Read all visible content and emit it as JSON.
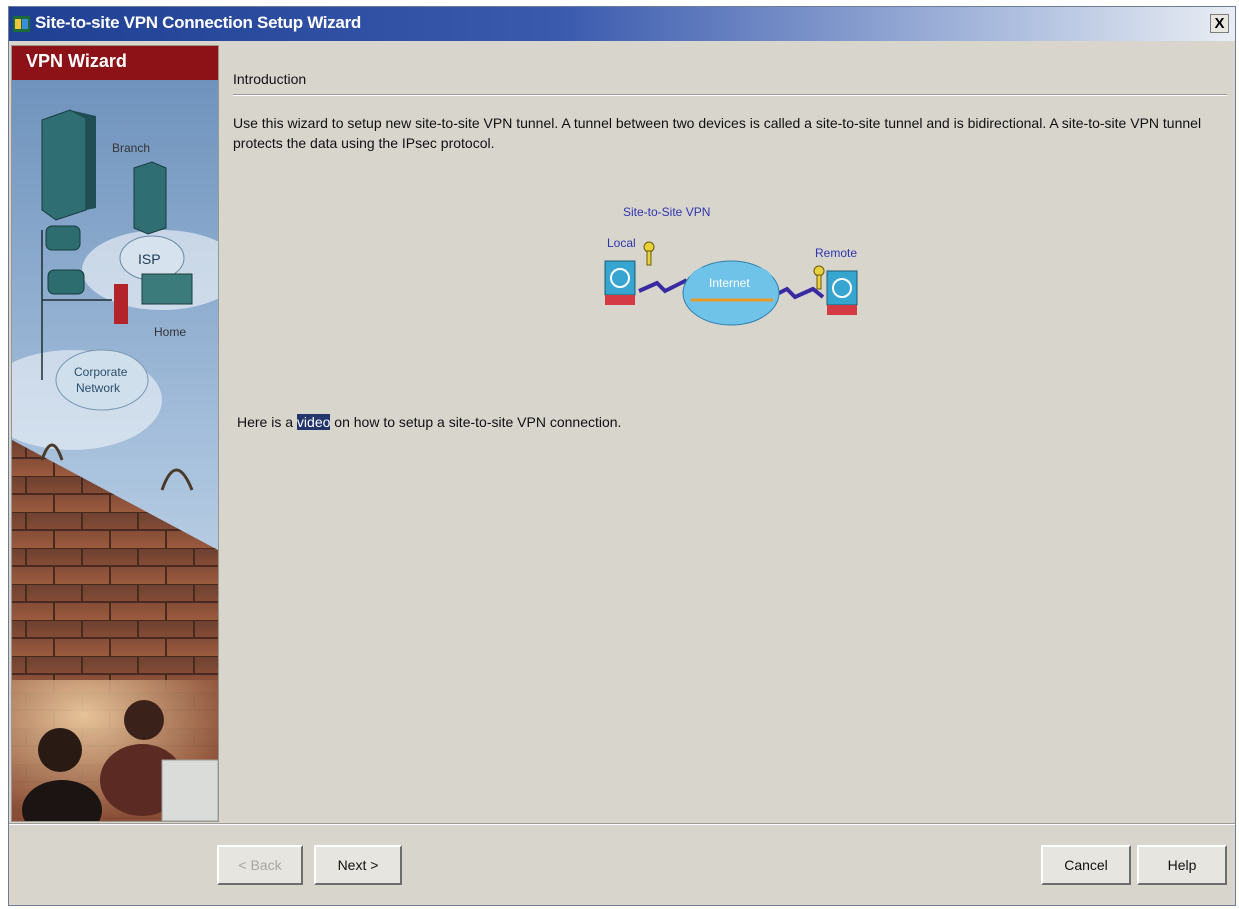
{
  "window": {
    "title": "Site-to-site VPN Connection Setup Wizard",
    "close_glyph": "X"
  },
  "sidebar": {
    "title": "VPN Wizard",
    "art_labels": {
      "branch": "Branch",
      "isp": "ISP",
      "home": "Home",
      "corporate_line1": "Corporate",
      "corporate_line2": "Network"
    }
  },
  "main": {
    "section_title": "Introduction",
    "intro_text": "Use this wizard to setup new site-to-site VPN tunnel. A tunnel between two devices is called a site-to-site tunnel and is bidirectional. A site-to-site VPN tunnel protects the data using the IPsec protocol.",
    "diagram": {
      "title": "Site-to-Site VPN",
      "local_label": "Local",
      "remote_label": "Remote",
      "internet_label": "Internet"
    },
    "video_prefix": "Here is a ",
    "video_link": "video",
    "video_suffix": " on how to setup a site-to-site VPN connection."
  },
  "buttons": {
    "back": "< Back",
    "next": "Next >",
    "cancel": "Cancel",
    "help": "Help"
  },
  "colors": {
    "title_bar_start": "#1f3f93",
    "sidebar_title_bg": "#8c1218",
    "dialog_bg": "#d8d5cd",
    "diagram_text": "#3034b0",
    "link_highlight": "#23356b"
  },
  "icons": [
    "app-icon",
    "close-icon",
    "key-icon",
    "firewall-icon",
    "cloud-icon"
  ]
}
